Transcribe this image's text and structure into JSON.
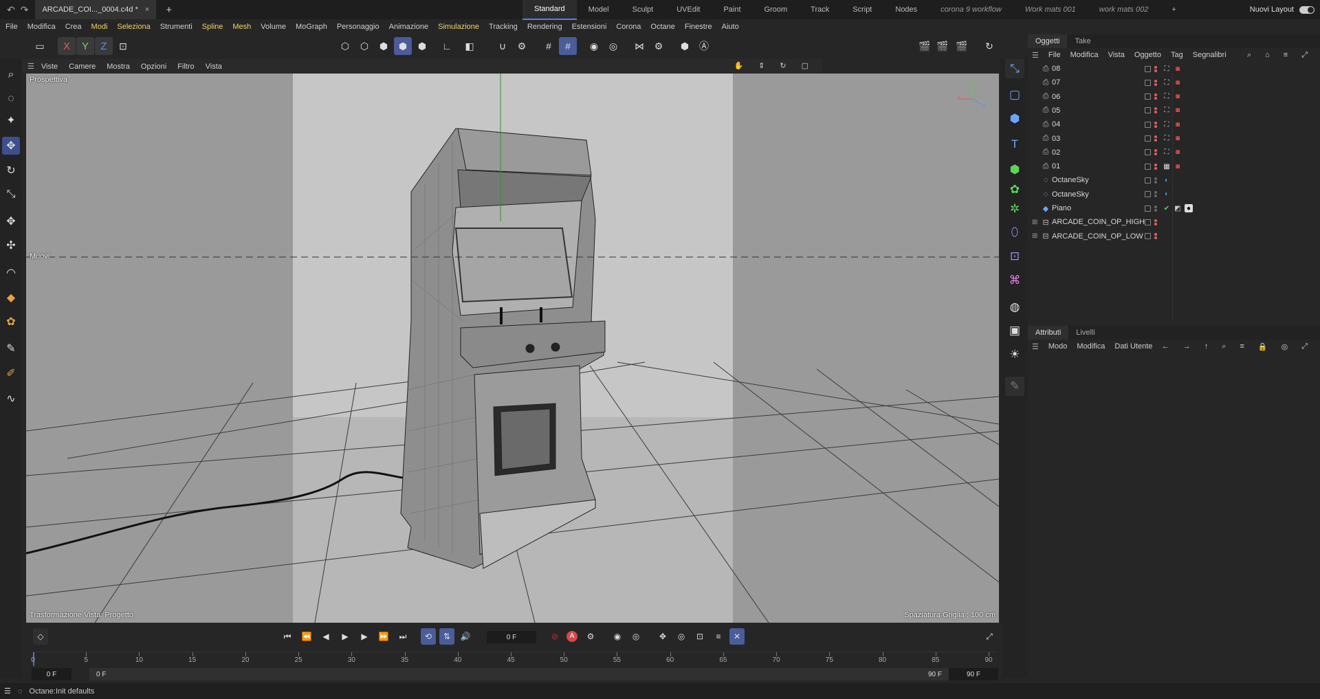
{
  "titlebar": {
    "doc_tab": "ARCADE_COI..._0004.c4d *",
    "close": "×",
    "add": "+"
  },
  "layouts": [
    "Standard",
    "Model",
    "Sculpt",
    "UVEdit",
    "Paint",
    "Groom",
    "Track",
    "Script",
    "Nodes",
    "corona 9 workflow",
    "Work mats 001",
    "work mats 002"
  ],
  "layouts_add": "+",
  "new_layout": "Nuovi Layout",
  "menubar": [
    {
      "label": "File",
      "y": false
    },
    {
      "label": "Modifica",
      "y": false
    },
    {
      "label": "Crea",
      "y": false
    },
    {
      "label": "Modi",
      "y": true
    },
    {
      "label": "Seleziona",
      "y": true
    },
    {
      "label": "Strumenti",
      "y": false
    },
    {
      "label": "Spline",
      "y": true
    },
    {
      "label": "Mesh",
      "y": true
    },
    {
      "label": "Volume",
      "y": false
    },
    {
      "label": "MoGraph",
      "y": false
    },
    {
      "label": "Personaggio",
      "y": false
    },
    {
      "label": "Animazione",
      "y": false
    },
    {
      "label": "Simulazione",
      "y": true
    },
    {
      "label": "Tracking",
      "y": false
    },
    {
      "label": "Rendering",
      "y": false
    },
    {
      "label": "Estensioni",
      "y": false
    },
    {
      "label": "Corona",
      "y": false
    },
    {
      "label": "Octane",
      "y": false
    },
    {
      "label": "Finestre",
      "y": false
    },
    {
      "label": "Aiuto",
      "y": false
    }
  ],
  "axes": {
    "x": "X",
    "y": "Y",
    "z": "Z"
  },
  "viewport_menu": [
    "Viste",
    "Camere",
    "Mostra",
    "Opzioni",
    "Filtro",
    "Vista"
  ],
  "viewport": {
    "camera": "Prospettiva",
    "axis_label": "Muovi",
    "view_transform": "Trasformazione Vista: Progetto",
    "grid_spacing": "Spaziatura Griglia : 100 cm"
  },
  "timeline": {
    "current": "0 F",
    "start": "0 F",
    "range_start": "0 F",
    "range_end": "90 F",
    "end": "90 F",
    "ticks": [
      0,
      5,
      10,
      15,
      20,
      25,
      30,
      35,
      40,
      45,
      50,
      55,
      60,
      65,
      70,
      75,
      80,
      85,
      90
    ],
    "max": 90,
    "record": "A"
  },
  "objects_panel": {
    "tabs": [
      "Oggetti",
      "Take"
    ],
    "menu": [
      "File",
      "Modifica",
      "Vista",
      "Oggetto",
      "Tag",
      "Segnalibri"
    ],
    "rows": [
      {
        "name": "08",
        "icon": "camera-icon",
        "tags": [
          "frame",
          "cam"
        ]
      },
      {
        "name": "07",
        "icon": "camera-icon",
        "tags": [
          "frame",
          "cam"
        ]
      },
      {
        "name": "06",
        "icon": "camera-icon",
        "tags": [
          "frame",
          "cam"
        ]
      },
      {
        "name": "05",
        "icon": "camera-icon",
        "tags": [
          "frame",
          "cam"
        ]
      },
      {
        "name": "04",
        "icon": "camera-icon",
        "tags": [
          "frame",
          "cam"
        ]
      },
      {
        "name": "03",
        "icon": "camera-icon",
        "tags": [
          "frame",
          "cam"
        ]
      },
      {
        "name": "02",
        "icon": "camera-icon",
        "tags": [
          "frame",
          "cam"
        ]
      },
      {
        "name": "01",
        "icon": "camera-icon",
        "tags": [
          "checker",
          "cam"
        ]
      },
      {
        "name": "OctaneSky",
        "icon": "sky-icon",
        "tags": [
          "octane"
        ]
      },
      {
        "name": "OctaneSky",
        "icon": "sky-icon",
        "tags": [
          "octane"
        ]
      },
      {
        "name": "Piano",
        "icon": "plane-icon",
        "tags": [
          "check",
          "material",
          "sphere"
        ]
      },
      {
        "name": "ARCADE_COIN_OP_HIGH",
        "icon": "null-icon",
        "tags": []
      },
      {
        "name": "ARCADE_COIN_OP_LOW",
        "icon": "null-icon",
        "tags": []
      }
    ]
  },
  "attributes_panel": {
    "tabs": [
      "Attributi",
      "Livelli"
    ],
    "menu": [
      "Modo",
      "Modifica",
      "Dati Utente"
    ]
  },
  "status": {
    "message": "Octane:Init defaults"
  },
  "colors": {
    "accent": "#5b7cf2",
    "active_tool": "#4a5c9a",
    "menu_highlight": "#f0d36a"
  }
}
